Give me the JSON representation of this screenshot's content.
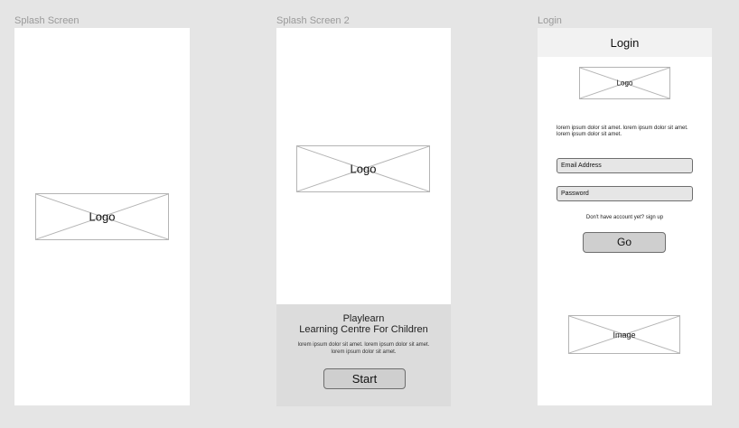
{
  "frames": {
    "splash": {
      "label": "Splash Screen",
      "logo": "Logo"
    },
    "splash2": {
      "label": "Splash Screen 2",
      "logo": "Logo",
      "title": "Playlearn",
      "subtitle": "Learning Centre For Children",
      "body": "lorem ipsum dolor sit amet. lorem ipsum dolor sit amet. lorem ipsum dolor sit amet.",
      "start_label": "Start"
    },
    "login": {
      "label": "Login",
      "header_title": "Login",
      "logo": "Logo",
      "description": "lorem ipsum dolor sit amet. lorem ipsum dolor sit amet. lorem ipsum dolor sit amet.",
      "email_placeholder": "Email Address",
      "password_placeholder": "Password",
      "signup_text": "Don't have account yet? sign up",
      "go_label": "Go",
      "image_label": "Image"
    }
  }
}
